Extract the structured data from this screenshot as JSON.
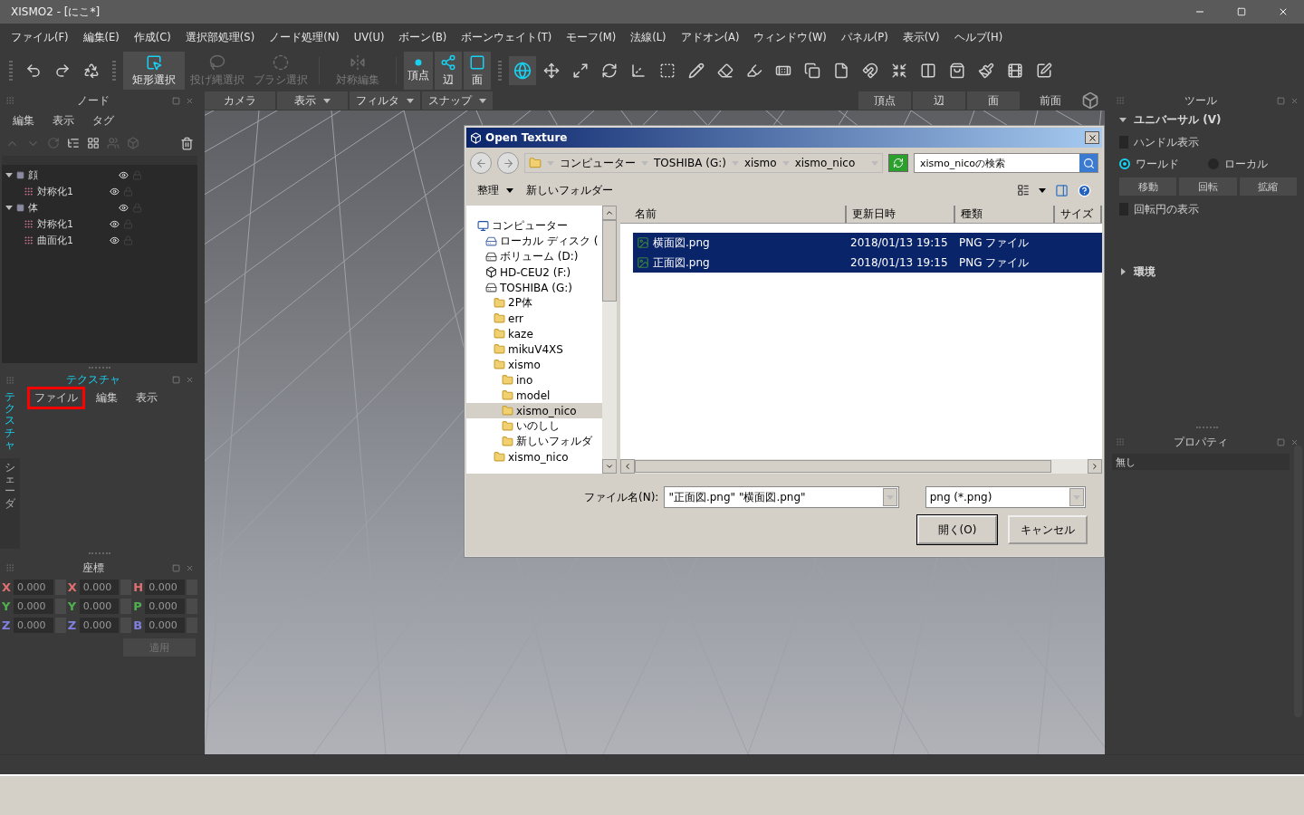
{
  "window": {
    "title": "XISMO2 - [にこ*]"
  },
  "menu": [
    "ファイル(F)",
    "編集(E)",
    "作成(C)",
    "選択部処理(S)",
    "ノード処理(N)",
    "UV(U)",
    "ボーン(B)",
    "ボーンウェイト(T)",
    "モーフ(M)",
    "法線(L)",
    "アドオン(A)",
    "ウィンドウ(W)",
    "パネル(P)",
    "表示(V)",
    "ヘルプ(H)"
  ],
  "toolbar": {
    "selection_tools": [
      {
        "label": "矩形選択",
        "selected": true,
        "disabled": false
      },
      {
        "label": "投げ縄選択",
        "selected": false,
        "disabled": true
      },
      {
        "label": "ブラシ選択",
        "selected": false,
        "disabled": true
      },
      {
        "label": "対称編集",
        "selected": false,
        "disabled": true
      }
    ],
    "component_modes": [
      {
        "label": "頂点",
        "selected": true
      },
      {
        "label": "辺",
        "selected": true
      },
      {
        "label": "面",
        "selected": true
      }
    ]
  },
  "node_panel": {
    "title": "ノード",
    "menu": [
      "編集",
      "表示",
      "タグ"
    ],
    "tree": [
      {
        "label": "顔",
        "kind": "object",
        "expanded": true,
        "children": [
          {
            "label": "対称化1",
            "kind": "modifier"
          }
        ]
      },
      {
        "label": "体",
        "kind": "object",
        "expanded": true,
        "children": [
          {
            "label": "対称化1",
            "kind": "modifier"
          },
          {
            "label": "曲面化1",
            "kind": "modifier"
          }
        ]
      }
    ]
  },
  "texture_panel": {
    "title": "テクスチャ",
    "side_tabs": [
      {
        "label": "テクスチャ",
        "selected": true
      },
      {
        "label": "シェーダ",
        "selected": false
      }
    ],
    "menu": [
      {
        "label": "ファイル",
        "highlighted": true
      },
      {
        "label": "編集",
        "highlighted": false
      },
      {
        "label": "表示",
        "highlighted": false
      }
    ]
  },
  "coordinates_panel": {
    "title": "座標",
    "fields": [
      {
        "axis": "X",
        "value": "0.000",
        "color": "#e07070"
      },
      {
        "axis": "X",
        "value": "0.000",
        "color": "#e07070"
      },
      {
        "axis": "H",
        "value": "0.000",
        "color": "#e07070"
      },
      {
        "axis": "Y",
        "value": "0.000",
        "color": "#50b050"
      },
      {
        "axis": "Y",
        "value": "0.000",
        "color": "#50b050"
      },
      {
        "axis": "P",
        "value": "0.000",
        "color": "#50b050"
      },
      {
        "axis": "Z",
        "value": "0.000",
        "color": "#8080e0"
      },
      {
        "axis": "Z",
        "value": "0.000",
        "color": "#8080e0"
      },
      {
        "axis": "B",
        "value": "0.000",
        "color": "#8080e0"
      }
    ],
    "apply_button": {
      "label": "適用",
      "disabled": true
    }
  },
  "viewport": {
    "menus": [
      {
        "label": "カメラ",
        "dropdown": false
      },
      {
        "label": "表示",
        "dropdown": true
      },
      {
        "label": "フィルタ",
        "dropdown": true
      },
      {
        "label": "スナップ",
        "dropdown": true
      }
    ],
    "view_buttons": [
      "頂点",
      "辺",
      "面"
    ],
    "view_name": "前面"
  },
  "tool_panel": {
    "title": "ツール",
    "section": {
      "label": "ユニバーサル (V)",
      "expanded": true
    },
    "handle_display": {
      "label": "ハンドル表示",
      "checked": false
    },
    "coordinate_modes": [
      {
        "label": "ワールド",
        "selected": true
      },
      {
        "label": "ローカル",
        "selected": false
      }
    ],
    "buttons": [
      "移動",
      "回転",
      "拡縮"
    ],
    "rotation_circle": {
      "label": "回転円の表示",
      "checked": false
    },
    "environment": {
      "label": "環境",
      "expanded": false
    }
  },
  "property_panel": {
    "title": "プロパティ",
    "value": "無し"
  },
  "dialog": {
    "title": "Open Texture",
    "breadcrumb": [
      "コンピューター",
      "TOSHIBA (G:)",
      "xismo",
      "xismo_nico"
    ],
    "search": {
      "placeholder": "xismo_nicoの検索"
    },
    "commands": [
      {
        "label": "整理",
        "dropdown": true
      },
      {
        "label": "新しいフォルダー",
        "dropdown": false
      }
    ],
    "nav_tree": [
      {
        "label": "コンピューター",
        "kind": "computer",
        "selected": false,
        "children": [
          {
            "label": "ローカル ディスク (",
            "kind": "system_disk",
            "selected": false
          },
          {
            "label": "ボリューム (D:)",
            "kind": "drive",
            "selected": false
          },
          {
            "label": "HD-CEU2 (F:)",
            "kind": "external",
            "selected": false
          },
          {
            "label": "TOSHIBA (G:)",
            "kind": "drive",
            "selected": false,
            "children": [
              {
                "label": "2P体",
                "kind": "folder",
                "selected": false
              },
              {
                "label": "err",
                "kind": "folder",
                "selected": false
              },
              {
                "label": "kaze",
                "kind": "folder",
                "selected": false
              },
              {
                "label": "mikuV4XS",
                "kind": "folder",
                "selected": false
              },
              {
                "label": "xismo",
                "kind": "folder",
                "selected": false,
                "children": [
                  {
                    "label": "ino",
                    "kind": "folder",
                    "selected": false
                  },
                  {
                    "label": "model",
                    "kind": "folder",
                    "selected": false
                  },
                  {
                    "label": "xismo_nico",
                    "kind": "folder",
                    "selected": true
                  },
                  {
                    "label": "いのしし",
                    "kind": "folder",
                    "selected": false
                  },
                  {
                    "label": "新しいフォルダ",
                    "kind": "folder",
                    "selected": false
                  }
                ]
              },
              {
                "label": "xismo_nico",
                "kind": "folder",
                "selected": false
              }
            ]
          }
        ]
      }
    ],
    "columns": [
      "名前",
      "更新日時",
      "種類",
      "サイズ"
    ],
    "files": [
      {
        "name": "横面図.png",
        "modified": "2018/01/13 19:15",
        "type": "PNG ファイル",
        "selected": true
      },
      {
        "name": "正面図.png",
        "modified": "2018/01/13 19:15",
        "type": "PNG ファイル",
        "selected": true
      }
    ],
    "filename_label": "ファイル名(N):",
    "filename": "\"正面図.png\" \"横面図.png\"",
    "filetype": "png (*.png)",
    "buttons": [
      "開く(O)",
      "キャンセル"
    ]
  }
}
